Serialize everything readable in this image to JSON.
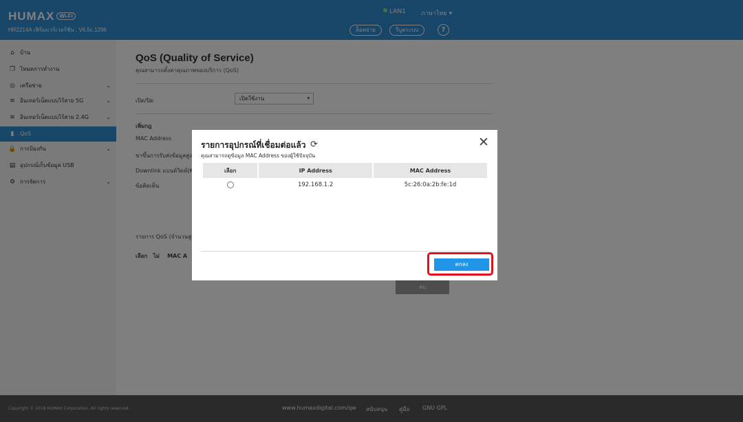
{
  "header": {
    "logo": "HUMAX",
    "logo_badge": "Wi-Fi",
    "model": "HR2214A เฟิร์มแวร์เวอร์ชัน : V6.5c.1296",
    "lan_status": "LAN1",
    "language": "ภาษาไทย",
    "logout_btn": "ล็อคย่าย",
    "reboot_btn": "รีบูตระบบ",
    "help_btn": "?"
  },
  "sidebar": {
    "items": [
      {
        "label": "บ้าน",
        "icon": "⌂",
        "icon_name": "home-icon"
      },
      {
        "label": "โหมดการทำงาน",
        "icon": "❐",
        "icon_name": "mode-icon"
      },
      {
        "label": "เครือข่าย",
        "icon": "◎",
        "icon_name": "network-icon",
        "chevron": "⌄"
      },
      {
        "label": "อินเทอร์เน็ตแบบไร้สาย 5G",
        "icon": "≋",
        "icon_name": "wifi-icon",
        "chevron": "⌄"
      },
      {
        "label": "อินเทอร์เน็ตแบบไร้สาย 2.4G",
        "icon": "≋",
        "icon_name": "wifi-icon",
        "chevron": "⌄"
      },
      {
        "label": "QoS",
        "icon": "▮",
        "icon_name": "qos-chart-icon",
        "active": true
      },
      {
        "label": "การป้องกัน",
        "icon": "🔒",
        "icon_name": "lock-icon",
        "chevron": "⌄"
      },
      {
        "label": "อุปกรณ์เก็บข้อมูล USB",
        "icon": "▤",
        "icon_name": "usb-storage-icon"
      },
      {
        "label": "การจัดการ",
        "icon": "⚙",
        "icon_name": "gear-icon",
        "chevron": "⌄"
      }
    ]
  },
  "main": {
    "title": "QoS (Quality of Service)",
    "subtitle": "คุณสามารถตั้งค่าคุณภาพของบริการ (QoS)",
    "enable_label": "เปิด/ปิด",
    "enable_value": "เปิดใช้งาน",
    "add_label": "เพิ่มกฎ",
    "mac_label": "MAC Address",
    "upload_label": "ขาขึ้นการรับส่งข้อมูลสูงสุด",
    "download_label": "Downlink แบนด์วิดท์(Kb",
    "note_label": "ข้อคิดเห็น",
    "list_label": "รายการ QoS (จำนวนสูง",
    "col_select": "เลือก",
    "col_no": "ไม่",
    "col_mac": "MAC A",
    "gray_btn": "ลบ"
  },
  "footer": {
    "copyright": "Copyright © 2018 HUMAX Corporation. All rights reserved.",
    "links": [
      "www.humaxdigital.com/qw",
      "สนับสนุน",
      "คู่มือ",
      "GNU GPL"
    ]
  },
  "modal": {
    "title": "รายการอุปกรณ์ที่เชื่อมต่อแล้ว",
    "refresh_icon": "⟳",
    "close_icon": "✕",
    "subtitle": "คุณสามารถดูข้อมูล MAC Address ของผู้ใช้ปัจจุบัน",
    "columns": [
      "เลือก",
      "IP Address",
      "MAC Address"
    ],
    "rows": [
      {
        "ip": "192.168.1.2",
        "mac": "5c:26:0a:2b:fe:1d"
      }
    ],
    "ok_btn": "ตกลง"
  }
}
